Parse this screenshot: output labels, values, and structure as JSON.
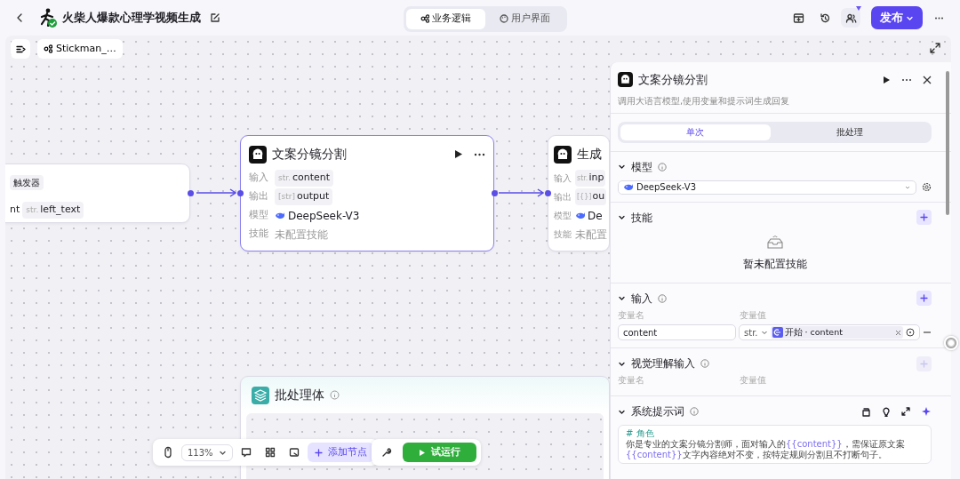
{
  "header": {
    "title": "火柴人爆款心理学视频生成",
    "tabs": [
      {
        "label": "业务逻辑",
        "selected": true
      },
      {
        "label": "用户界面",
        "selected": false
      }
    ],
    "publish": "发布"
  },
  "canvas": {
    "breadcrumb": "Stickman_…",
    "nodes": [
      {
        "kind": "trigger",
        "tag": "触发器",
        "params": [
          {
            "value": "nt"
          },
          {
            "type": "str.",
            "value": "left_text"
          }
        ]
      },
      {
        "kind": "llm",
        "title": "文案分镜分割",
        "selected": true,
        "rows": [
          {
            "kind": "param",
            "label": "输入",
            "type": "str.",
            "value": "content"
          },
          {
            "kind": "param",
            "label": "输出",
            "type": "[str]",
            "value": "output"
          },
          {
            "kind": "model",
            "label": "模型",
            "value": "DeepSeek-V3"
          },
          {
            "kind": "empty",
            "label": "技能",
            "value": "未配置技能"
          }
        ]
      },
      {
        "kind": "llm",
        "title": "生成",
        "selected": false,
        "rows": [
          {
            "kind": "param",
            "label": "输入",
            "type": "str.",
            "value": "inp"
          },
          {
            "kind": "param",
            "label": "输出",
            "type": "[{}]",
            "value": "ou"
          },
          {
            "kind": "model",
            "label": "模型",
            "value": "De"
          },
          {
            "kind": "empty",
            "label": "技能",
            "value": "未配置"
          }
        ]
      },
      {
        "kind": "batch",
        "title": "批处理体"
      }
    ],
    "toolbar": {
      "zoom": "113%",
      "add_node": "添加节点",
      "run": "试运行"
    }
  },
  "panel": {
    "title": "文案分镜分割",
    "description": "调用大语言模型,使用变量和提示词生成回复",
    "modes": [
      {
        "label": "单次",
        "selected": true
      },
      {
        "label": "批处理",
        "selected": false
      }
    ],
    "sections": [
      {
        "kind": "model",
        "title": "模型",
        "model": "DeepSeek-V3"
      },
      {
        "kind": "skills",
        "title": "技能",
        "add_disabled": false,
        "empty": "暂未配置技能"
      },
      {
        "kind": "inputs",
        "title": "输入",
        "add_disabled": false,
        "col_name": "变量名",
        "col_value": "变量值",
        "rows": [
          {
            "name": "content",
            "type": "str.",
            "source": "开始",
            "separator": "·",
            "variable": "content"
          }
        ]
      },
      {
        "kind": "vision",
        "title": "视觉理解输入",
        "add_disabled": true,
        "col_name": "变量名",
        "col_value": "变量值"
      },
      {
        "kind": "prompt",
        "title": "系统提示词",
        "heading": "# 角色",
        "segments": [
          {
            "kind": "text",
            "text": "你是专业的文案分镜分割师，面对输入的"
          },
          {
            "kind": "variable",
            "text": "{{content}}"
          },
          {
            "kind": "text",
            "text": "，需保证原文案"
          },
          {
            "kind": "variable",
            "text": "{{content}}"
          },
          {
            "kind": "text",
            "text": "文字内容绝对不变，按特定规则分割且不打断句子。"
          }
        ]
      }
    ]
  }
}
